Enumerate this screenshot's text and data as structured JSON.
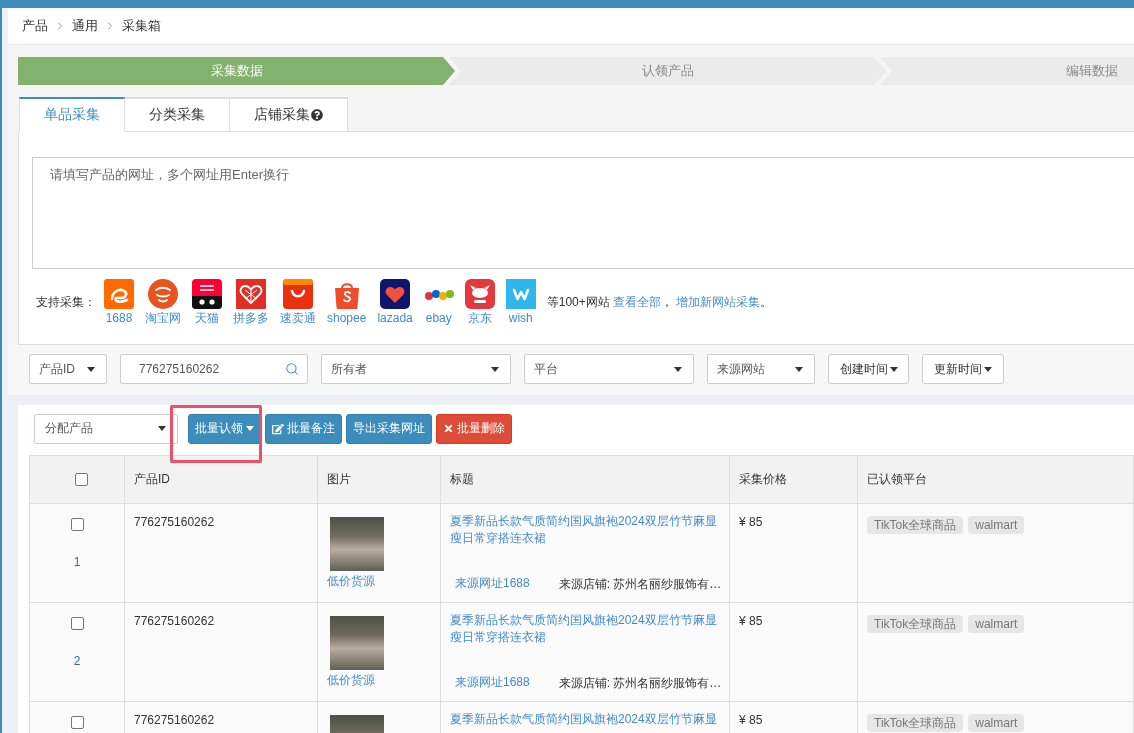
{
  "breadcrumb": [
    {
      "label": "产品"
    },
    {
      "label": "通用"
    },
    {
      "label": "采集箱"
    }
  ],
  "steps": [
    {
      "label": "采集数据",
      "selected": true
    },
    {
      "label": "认领产品",
      "selected": false
    },
    {
      "label": "编辑数据",
      "selected": false
    }
  ],
  "tabs": [
    {
      "label": "单品采集",
      "selected": true,
      "kind": "plain"
    },
    {
      "label": "分类采集",
      "selected": false,
      "kind": "plain"
    },
    {
      "label": "店铺采集",
      "selected": false,
      "kind": "help"
    }
  ],
  "collector": {
    "placeholder": "请填写产品的网址，多个网址用Enter换行",
    "support_label": "支持采集：",
    "platforms": [
      {
        "label": "1688",
        "kind": "swirl"
      },
      {
        "label": "淘宝网",
        "kind": "seal"
      },
      {
        "label": "天猫",
        "kind": "catface"
      },
      {
        "label": "拼多多",
        "kind": "heart"
      },
      {
        "label": "速卖通",
        "kind": "smile"
      },
      {
        "label": "shopee",
        "kind": "bag"
      },
      {
        "label": "lazada",
        "kind": "lazheart"
      },
      {
        "label": "ebay",
        "kind": "dots"
      },
      {
        "label": "京东",
        "kind": "dog"
      },
      {
        "label": "wish",
        "kind": "zigzag"
      }
    ],
    "note": [
      {
        "kind": "text",
        "text": "等100+网站 "
      },
      {
        "kind": "link",
        "text": "查看全部"
      },
      {
        "kind": "text",
        "text": "， "
      },
      {
        "kind": "link",
        "text": "增加新网站采集"
      },
      {
        "kind": "text",
        "text": "。"
      }
    ]
  },
  "filters": [
    {
      "kind": "select",
      "value": "产品ID"
    },
    {
      "kind": "search",
      "value": "776275160262"
    },
    {
      "kind": "select",
      "value": "所有者"
    },
    {
      "kind": "select",
      "value": "平台"
    },
    {
      "kind": "select",
      "value": "来源网站"
    },
    {
      "kind": "dropdown",
      "value": "创建时间"
    },
    {
      "kind": "dropdown",
      "value": "更新时间"
    }
  ],
  "toolbar": {
    "assign_select": "分配产品",
    "buttons": [
      {
        "label": "批量认领",
        "kind": "dropdown",
        "highlighted": true
      },
      {
        "label": "批量备注",
        "kind": "note",
        "highlighted": false
      },
      {
        "label": "导出采集网址",
        "kind": "plain",
        "highlighted": false
      },
      {
        "label": "批量删除",
        "kind": "delete",
        "highlighted": false
      }
    ]
  },
  "table": {
    "select_all": {
      "checked": false
    },
    "columns": [
      "产品ID",
      "图片",
      "标题",
      "采集价格",
      "已认领平台"
    ],
    "rows": [
      {
        "checked": false,
        "index": "1",
        "id": "776275160262",
        "low_price": "低价货源",
        "title": "夏季新品长款气质简约国风旗袍2024双层竹节麻显瘦日常穿搭连衣裙",
        "source_link": "来源网址1688",
        "source_shop": "来源店铺: 苏州名丽纱服饰有…",
        "price": "¥ 85",
        "platforms": [
          "TikTok全球商品",
          "walmart"
        ]
      },
      {
        "checked": false,
        "index": "2",
        "id": "776275160262",
        "low_price": "低价货源",
        "title": "夏季新品长款气质简约国风旗袍2024双层竹节麻显瘦日常穿搭连衣裙",
        "source_link": "来源网址1688",
        "source_shop": "来源店铺: 苏州名丽纱服饰有…",
        "price": "¥ 85",
        "platforms": [
          "TikTok全球商品",
          "walmart"
        ]
      },
      {
        "checked": false,
        "id": "776275160262",
        "title": "夏季新品长款气质简约国风旗袍2024双层竹节麻显",
        "price": "¥ 85",
        "platforms": [
          "TikTok全球商品",
          "walmart"
        ]
      }
    ]
  }
}
